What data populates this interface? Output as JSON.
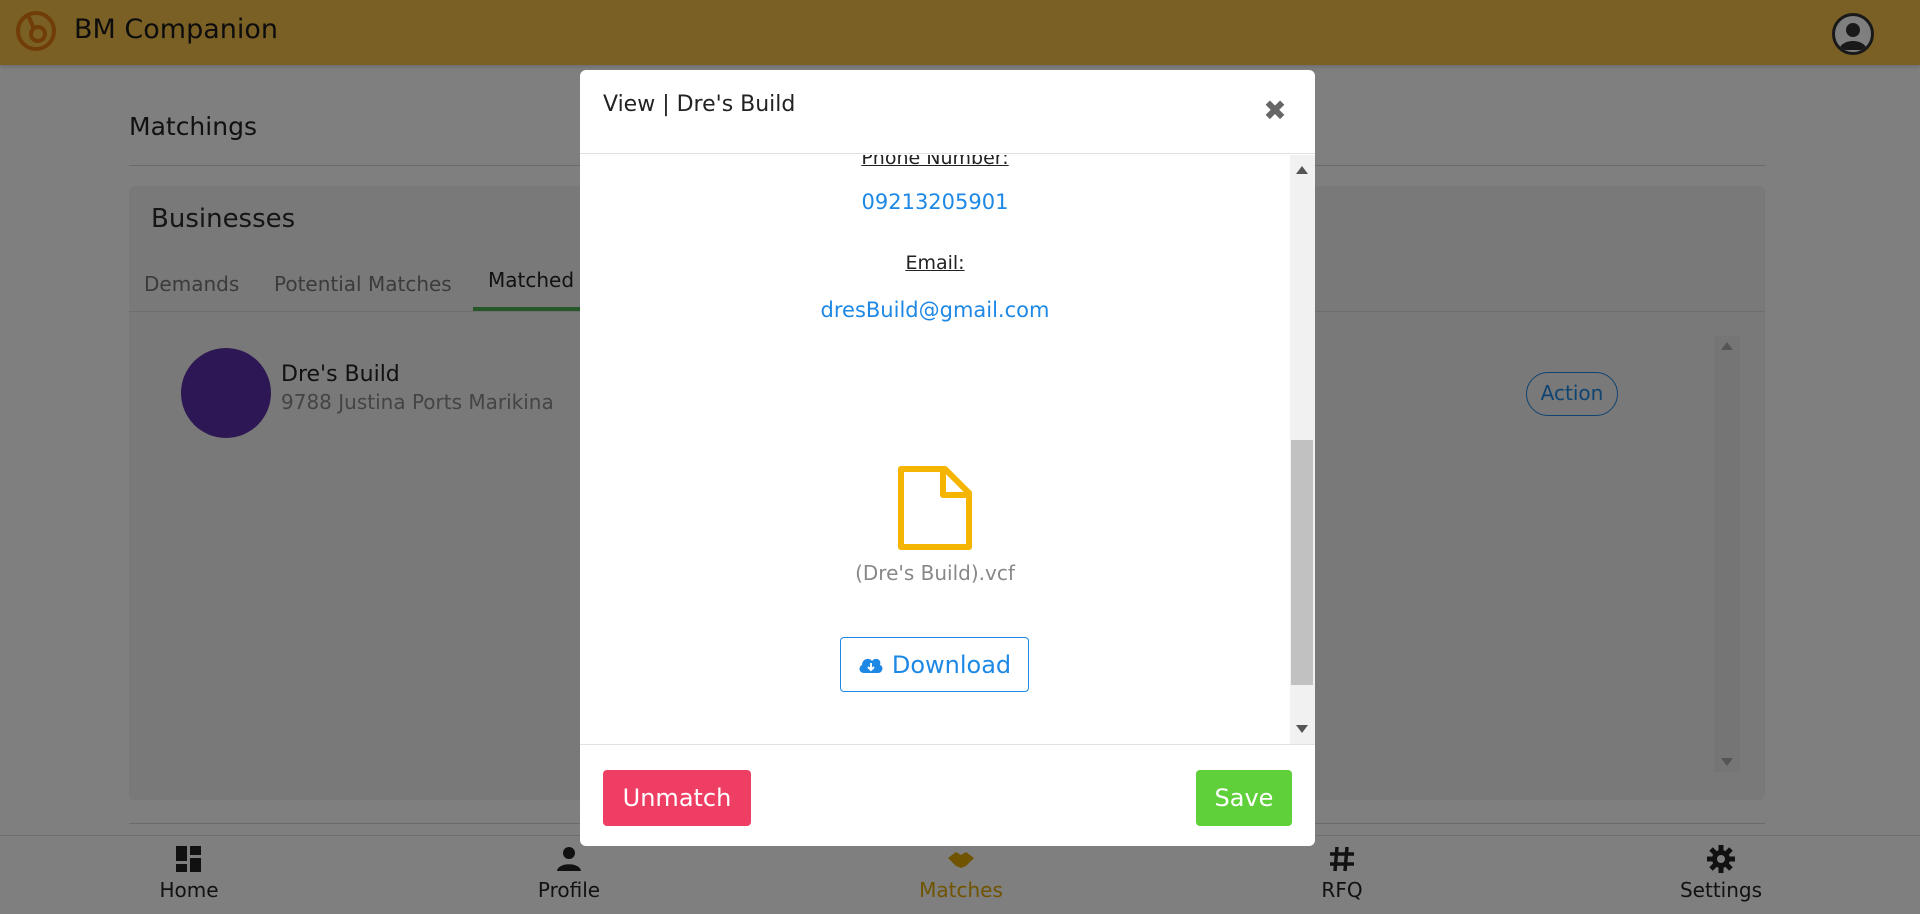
{
  "app": {
    "title": "BM Companion"
  },
  "page": {
    "title": "Matchings"
  },
  "card": {
    "title": "Businesses",
    "tabs": [
      {
        "label": "Demands"
      },
      {
        "label": "Potential Matches"
      },
      {
        "label": "Matched"
      }
    ],
    "items": [
      {
        "name": "Dre's Build",
        "address": "9788 Justina Ports Marikina",
        "action_label": "Action"
      }
    ]
  },
  "nav": {
    "items": [
      {
        "label": "Home",
        "icon": "dashboard-icon"
      },
      {
        "label": "Profile",
        "icon": "person-icon"
      },
      {
        "label": "Matches",
        "icon": "handshake-icon"
      },
      {
        "label": "RFQ",
        "icon": "hash-icon"
      },
      {
        "label": "Settings",
        "icon": "gear-icon"
      }
    ],
    "active": "Matches"
  },
  "modal": {
    "title": "View | Dre's Build",
    "close_symbol": "✖",
    "phone_label": "Phone Number:",
    "phone_value": "09213205901",
    "email_label": "Email:",
    "email_value": "dresBuild@gmail.com",
    "file_name": "(Dre's Build).vcf",
    "download_label": "Download",
    "unmatch_label": "Unmatch",
    "save_label": "Save"
  },
  "colors": {
    "header": "#f5c04a",
    "accent_blue": "#1e88e5",
    "unmatch": "#ef3e64",
    "save": "#5fcf3a",
    "file_icon": "#f5b400",
    "tab_underline": "#4caf50",
    "business_avatar": "#5b2ea8"
  }
}
